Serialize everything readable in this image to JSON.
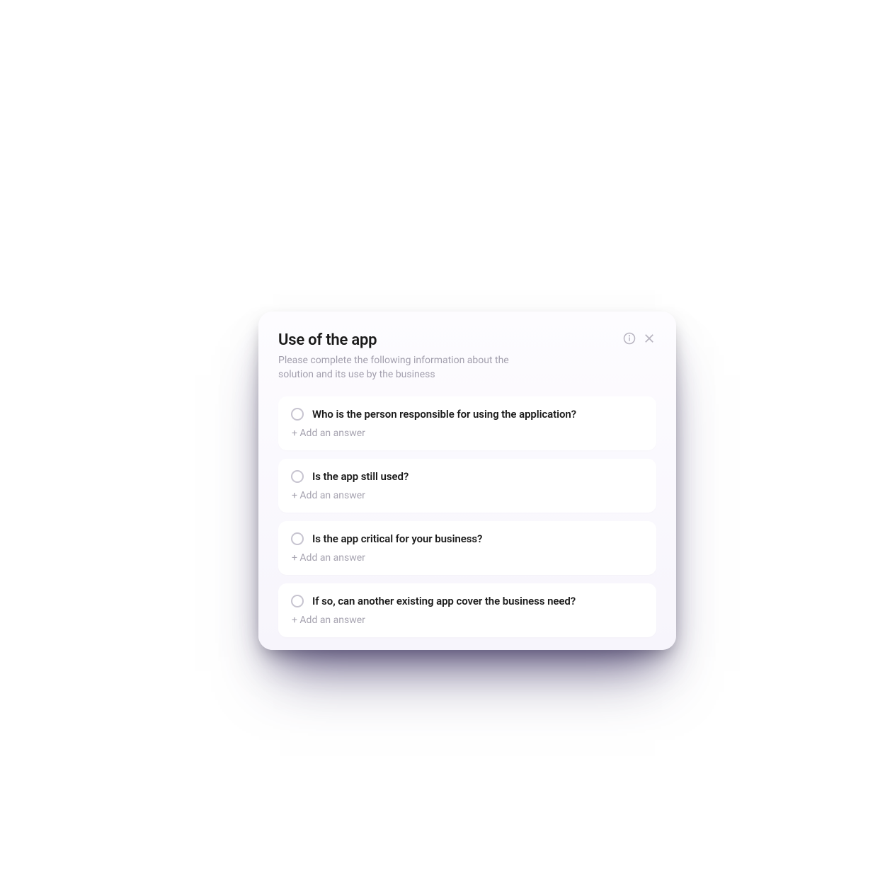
{
  "modal": {
    "title": "Use of the app",
    "subtitle": "Please complete the following information about the solution and its use by the business",
    "questions": [
      {
        "text": "Who is the person responsible for using the application?",
        "add_answer_label": "+ Add an answer"
      },
      {
        "text": "Is the app still used?",
        "add_answer_label": "+ Add an answer"
      },
      {
        "text": "Is the app critical for your business?",
        "add_answer_label": "+ Add an answer"
      },
      {
        "text": "If so, can another existing app cover the business need?",
        "add_answer_label": "+ Add an answer"
      }
    ]
  }
}
